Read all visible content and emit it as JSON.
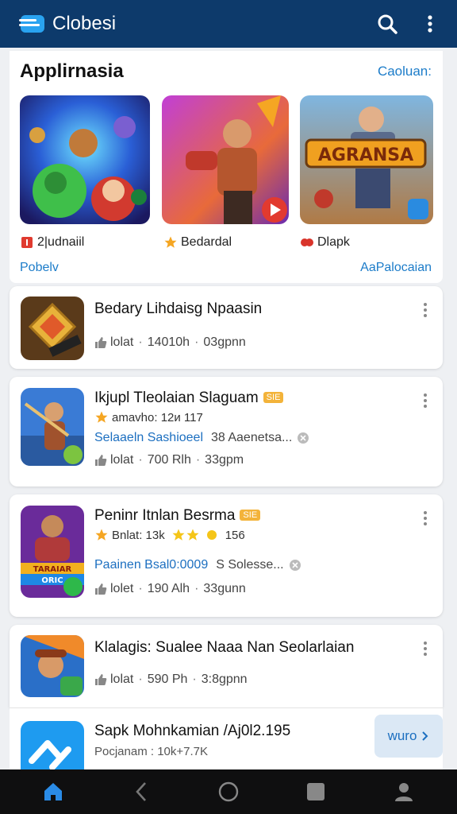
{
  "header": {
    "app_title": "Clobesi",
    "icons": [
      "menu-logo-icon",
      "search-icon",
      "more-vert-icon"
    ]
  },
  "featured": {
    "title": "Applirnasia",
    "link": "Caoluan:",
    "items": [
      {
        "label": "2|udnaiil",
        "icon": "red-square-icon"
      },
      {
        "label": "Bedardal",
        "icon": "star-icon"
      },
      {
        "label": "Dlapk",
        "icon": "red-badge-icon"
      }
    ],
    "sub_left": "Pobelv",
    "sub_right": "AaPalocaian",
    "banner_text": "AGRANSA"
  },
  "apps": [
    {
      "title": "Bedary Lihdaisg Npaasin",
      "rating": "lolat",
      "size": "14010h",
      "downloads": "03gpnn"
    },
    {
      "title": "Ikjupl Tleolaian Slaguam",
      "badge": "SIE",
      "line2": "amavho: 12и 117",
      "line3_blue": "Selaaeln Sashioeel",
      "line3_gray": "38 Aaenetsa...",
      "rating": "lolat",
      "size": "700 Rlh",
      "downloads": "33gpm"
    },
    {
      "title": "Peninr Itnlan Besrma",
      "badge": "SIE",
      "line2": "Bnlat: 13k",
      "line2_count": "156",
      "line3_blue": "Paainen Bsal0:0009",
      "line3_gray": "S Solesse...",
      "rating": "lolet",
      "size": "190 Alh",
      "downloads": "33gunn",
      "thumb_text_1": "TARAIAR",
      "thumb_text_2": "ORIC"
    },
    {
      "title": "Klalagis: Sualee Naaa Nan Seolarlaian",
      "rating": "lolat",
      "size": "590 Ph",
      "downloads": "3:8gpnn"
    },
    {
      "title": "Sapk Mohnkamian /Aj0l2.195",
      "line2": "Pocjanam : 10k+7.7K",
      "install_label": "wuro"
    }
  ],
  "nav": [
    "home-icon",
    "back-icon",
    "circle-home-icon",
    "square-recents-icon",
    "profile-icon"
  ],
  "colors": {
    "header_bg": "#0d3a6b",
    "accent": "#1c7cc9",
    "nav_bg": "#0f0f10"
  }
}
